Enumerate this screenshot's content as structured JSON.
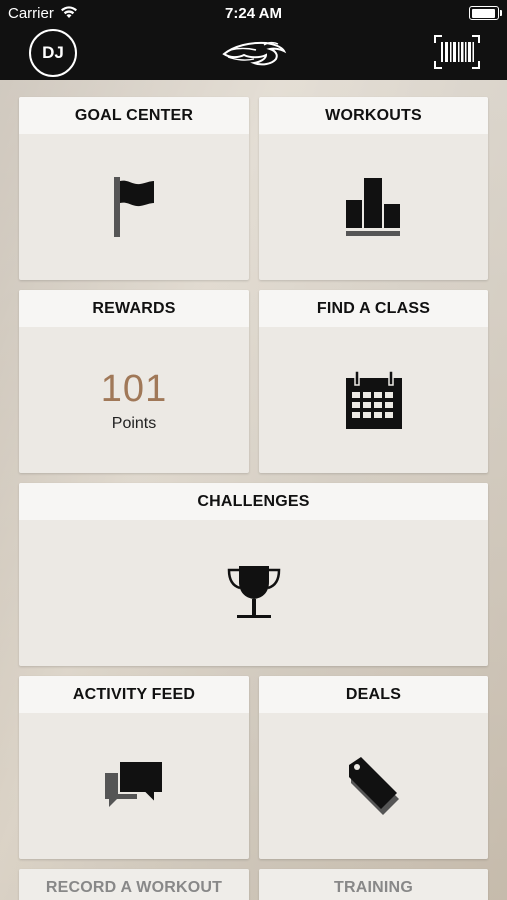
{
  "status_bar": {
    "carrier": "Carrier",
    "time": "7:24 AM"
  },
  "nav": {
    "avatar_initials": "DJ",
    "logo_icon": "horse-logo-icon",
    "barcode_icon": "barcode-scan-icon"
  },
  "tiles": {
    "goal_center": {
      "label": "GOAL CENTER",
      "icon": "flag-icon"
    },
    "workouts": {
      "label": "WORKOUTS",
      "icon": "bar-chart-icon"
    },
    "rewards": {
      "label": "REWARDS",
      "points_value": "101",
      "points_label": "Points"
    },
    "find_a_class": {
      "label": "FIND A CLASS",
      "icon": "calendar-icon"
    },
    "challenges": {
      "label": "CHALLENGES",
      "icon": "trophy-icon"
    },
    "activity_feed": {
      "label": "ACTIVITY FEED",
      "icon": "chat-bubbles-icon"
    },
    "deals": {
      "label": "DEALS",
      "icon": "price-tag-icon"
    },
    "record_a_workout": {
      "label": "RECORD A WORKOUT"
    },
    "training": {
      "label": "TRAINING"
    }
  },
  "colors": {
    "bar_bg": "#111111",
    "tile_bg": "#ece9e4",
    "tile_header_bg": "#f7f6f4",
    "points_accent": "#a07858"
  }
}
